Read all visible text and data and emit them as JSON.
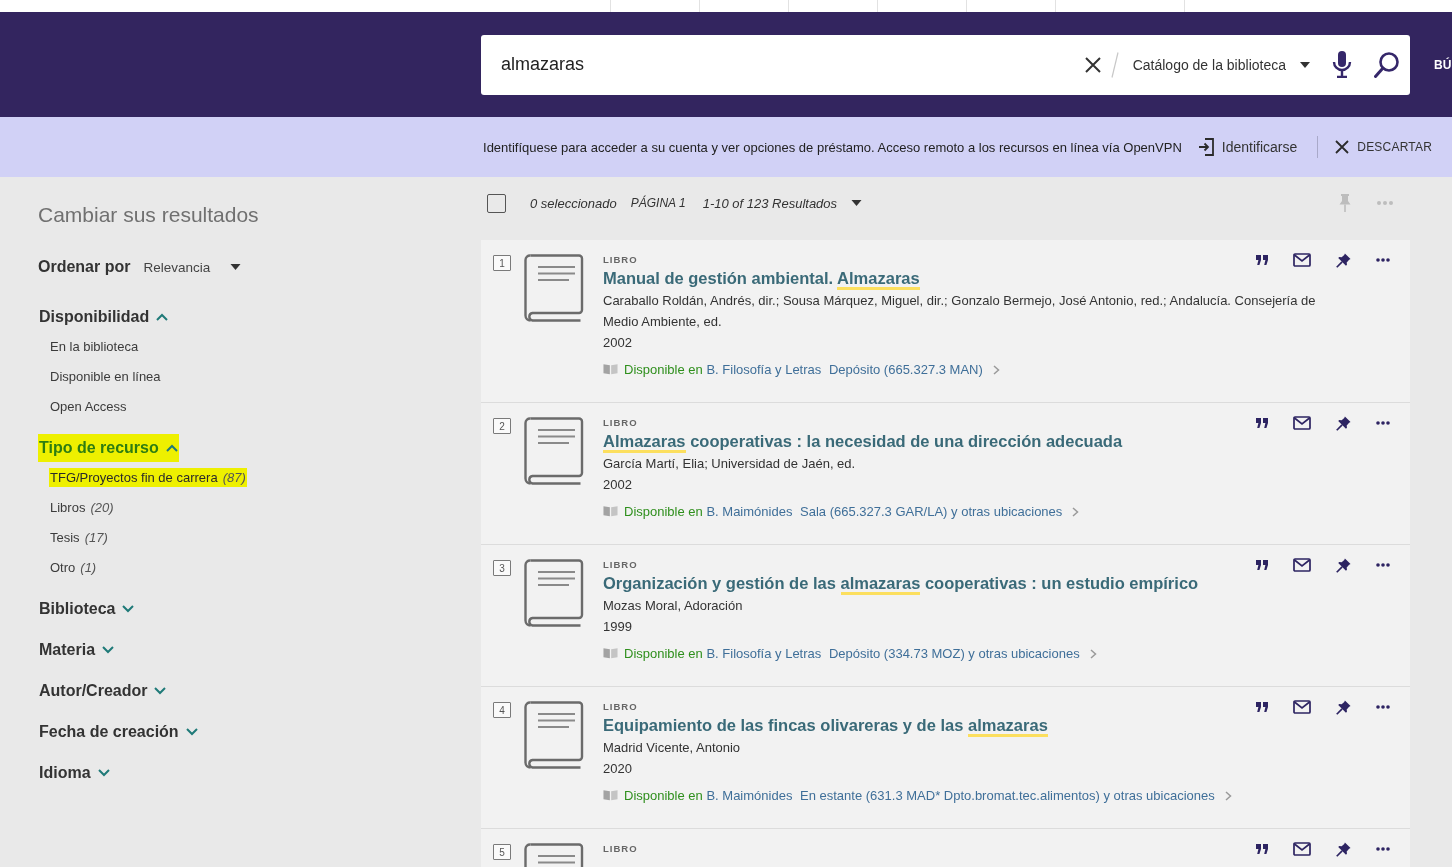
{
  "search": {
    "value": "almazaras",
    "scope": "Catálogo de la biblioteca",
    "side_label": "BÚ"
  },
  "notice": {
    "message": "Identifíquese para acceder a su cuenta y ver opciones de préstamo. Acceso remoto a los recursos en línea vía OpenVPN",
    "sign_in": "Identificarse",
    "dismiss": "DESCARTAR"
  },
  "sidebar": {
    "title": "Cambiar sus resultados",
    "sort": {
      "label": "Ordenar por",
      "value": "Relevancia"
    },
    "facets": [
      {
        "label": "Disponibilidad",
        "expanded": true,
        "highlighted": false,
        "items": [
          {
            "label": "En la biblioteca",
            "highlighted": false
          },
          {
            "label": "Disponible en línea",
            "highlighted": false
          },
          {
            "label": "Open Access",
            "highlighted": false
          }
        ]
      },
      {
        "label": "Tipo de recurso",
        "expanded": true,
        "highlighted": true,
        "items": [
          {
            "label": "TFG/Proyectos fin de carrera",
            "count": "(87)",
            "highlighted": true
          },
          {
            "label": "Libros",
            "count": "(20)",
            "highlighted": false
          },
          {
            "label": "Tesis",
            "count": "(17)",
            "highlighted": false
          },
          {
            "label": "Otro",
            "count": "(1)",
            "highlighted": false
          }
        ]
      },
      {
        "label": "Biblioteca",
        "expanded": false,
        "highlighted": false
      },
      {
        "label": "Materia",
        "expanded": false,
        "highlighted": false
      },
      {
        "label": "Autor/Creador",
        "expanded": false,
        "highlighted": false
      },
      {
        "label": "Fecha de creación",
        "expanded": false,
        "highlighted": false
      },
      {
        "label": "Idioma",
        "expanded": false,
        "highlighted": false
      }
    ]
  },
  "results_bar": {
    "checked": false,
    "selected_count": "0 seleccionado",
    "page": "PÁGINA 1",
    "range": "1-10 of 123 Resultados"
  },
  "results": [
    {
      "number": "1",
      "type": "LIBRO",
      "title": [
        {
          "text": "Manual de gestión ambiental.",
          "match": false
        },
        {
          "text": "Almazaras",
          "match": true
        }
      ],
      "authors": "Caraballo Roldán, Andrés, dir.; Sousa Márquez, Miguel, dir.; Gonzalo Bermejo, José Antonio, red.; Andalucía. Consejería de Medio Ambiente, ed.",
      "year": "2002",
      "availability": {
        "status": "Disponible en",
        "library": "B. Filosofía y Letras",
        "location": "Depósito (665.327.3 MAN)"
      }
    },
    {
      "number": "2",
      "type": "LIBRO",
      "title": [
        {
          "text": "Almazaras",
          "match": true
        },
        {
          "text": "cooperativas : la necesidad de una dirección adecuada",
          "match": false
        }
      ],
      "authors": "García Martí, Elia; Universidad de Jaén, ed.",
      "year": "2002",
      "availability": {
        "status": "Disponible en",
        "library": "B. Maimónides",
        "location": "Sala (665.327.3 GAR/LA) y otras ubicaciones"
      }
    },
    {
      "number": "3",
      "type": "LIBRO",
      "title": [
        {
          "text": "Organización y gestión de las",
          "match": false
        },
        {
          "text": "almazaras",
          "match": true
        },
        {
          "text": "cooperativas : un estudio empírico",
          "match": false
        }
      ],
      "authors": "Mozas Moral, Adoración",
      "year": "1999",
      "availability": {
        "status": "Disponible en",
        "library": "B. Filosofía y Letras",
        "location": "Depósito (334.73 MOZ) y otras ubicaciones"
      }
    },
    {
      "number": "4",
      "type": "LIBRO",
      "title": [
        {
          "text": "Equipamiento de las fincas olivareras y de las",
          "match": false
        },
        {
          "text": "almazaras",
          "match": true
        }
      ],
      "authors": "Madrid Vicente, Antonio",
      "year": "2020",
      "availability": {
        "status": "Disponible en",
        "library": "B. Maimónides",
        "location": "En estante (631.3 MAD* Dpto.bromat.tec.alimentos) y otras ubicaciones"
      }
    },
    {
      "number": "5",
      "type": "LIBRO"
    }
  ]
}
